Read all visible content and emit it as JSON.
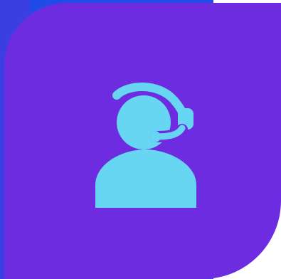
{
  "icon": {
    "name": "customer-support-headset-icon",
    "color": "#67d6f2"
  },
  "colors": {
    "card": "#6e2ce0",
    "back_layer": "#1f4be8",
    "back_layer_shade": "#3a3fe4",
    "background": "#ffffff"
  }
}
